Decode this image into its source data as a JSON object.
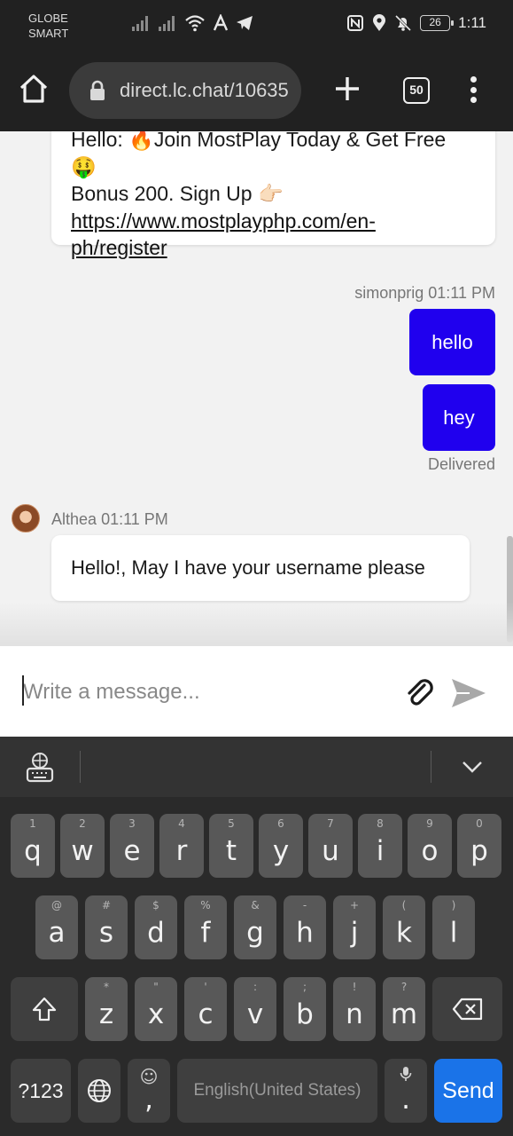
{
  "status_bar": {
    "carrier_line1": "GLOBE",
    "carrier_line2": "SMART",
    "battery": "26",
    "time": "1:11"
  },
  "browser": {
    "url": "direct.lc.chat/10635",
    "tab_count": "50"
  },
  "chat": {
    "messages": [
      {
        "type": "agent_promo",
        "text_line1": "Hello: 🔥Join MostPlay Today & Get Free 🤑",
        "text_line2": "Bonus 200. Sign Up 👉🏻",
        "link_line1": "https://www.mostplayphp.com/en-",
        "link_line2": "ph/register"
      },
      {
        "type": "customer",
        "author": "simonprig",
        "time": "01:11 PM",
        "bubbles": [
          "hello",
          "hey"
        ],
        "status": "Delivered"
      },
      {
        "type": "agent",
        "author": "Althea",
        "time": "01:11 PM",
        "text": "Hello!, May I have your username please"
      }
    ]
  },
  "composer": {
    "placeholder": "Write a message..."
  },
  "keyboard": {
    "row1": [
      {
        "key": "q",
        "hint": "1"
      },
      {
        "key": "w",
        "hint": "2"
      },
      {
        "key": "e",
        "hint": "3"
      },
      {
        "key": "r",
        "hint": "4"
      },
      {
        "key": "t",
        "hint": "5"
      },
      {
        "key": "y",
        "hint": "6"
      },
      {
        "key": "u",
        "hint": "7"
      },
      {
        "key": "i",
        "hint": "8"
      },
      {
        "key": "o",
        "hint": "9"
      },
      {
        "key": "p",
        "hint": "0"
      }
    ],
    "row2": [
      {
        "key": "a",
        "hint": "@"
      },
      {
        "key": "s",
        "hint": "#"
      },
      {
        "key": "d",
        "hint": "$"
      },
      {
        "key": "f",
        "hint": "%"
      },
      {
        "key": "g",
        "hint": "&"
      },
      {
        "key": "h",
        "hint": "-"
      },
      {
        "key": "j",
        "hint": "+"
      },
      {
        "key": "k",
        "hint": "("
      },
      {
        "key": "l",
        "hint": ")"
      }
    ],
    "row3": [
      {
        "key": "z",
        "hint": "*"
      },
      {
        "key": "x",
        "hint": "\""
      },
      {
        "key": "c",
        "hint": "'"
      },
      {
        "key": "v",
        "hint": ":"
      },
      {
        "key": "b",
        "hint": ";"
      },
      {
        "key": "n",
        "hint": "!"
      },
      {
        "key": "m",
        "hint": "?"
      }
    ],
    "symbols_key": "?123",
    "comma_key": ",",
    "emoji_hint": "☺",
    "space_label": "English(United States)",
    "period_key": ".",
    "send_key": "Send"
  },
  "colors": {
    "sent_bubble": "#2000ee",
    "send_key": "#1a73e8",
    "chrome_bg": "#212121"
  }
}
